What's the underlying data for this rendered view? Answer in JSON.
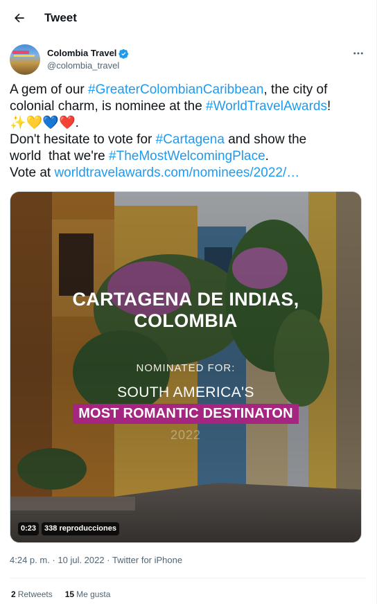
{
  "header": {
    "title": "Tweet"
  },
  "author": {
    "name": "Colombia Travel",
    "handle": "@colombia_travel"
  },
  "tweet": {
    "line1_pre": "A gem of our ",
    "line1_tag": "#GreaterColombianCaribbean",
    "line1_post": ", the city of",
    "line2_pre": "colonial charm, is nominee at the ",
    "line2_tag": "#WorldTravelAwards",
    "line2_post": "!",
    "line3_emoji": "✨💛💙❤️",
    "line3_post": ".",
    "line4_pre": "Don't hesitate to vote for ",
    "line4_tag": "#Cartagena",
    "line4_post": " and show the",
    "line5_pre": "world  that we're ",
    "line5_tag": "#TheMostWelcomingPlace",
    "line5_post": ".",
    "line6_pre": "Vote at ",
    "line6_link": "worldtravelawards.com/nominees/2022/…"
  },
  "media": {
    "city_line1": "CARTAGENA DE INDIAS,",
    "city_line2": "COLOMBIA",
    "nominated": "NOMINATED FOR:",
    "region": "SOUTH AMERICA'S",
    "banner": "MOST ROMANTIC DESTINATON",
    "year": "2022",
    "duration": "0:23",
    "views": "338 reproducciones"
  },
  "meta": {
    "time": "4:24 p. m.",
    "sep1": " · ",
    "date": "10 jul. 2022",
    "sep2": " · ",
    "source": "Twitter for iPhone"
  },
  "stats": {
    "retweets_count": "2",
    "retweets_label": "Retweets",
    "likes_count": "15",
    "likes_label": "Me gusta"
  },
  "colors": {
    "link": "#1d9bf0",
    "banner": "#a52680",
    "verified": "#1d9bf0"
  },
  "icons": [
    "back-arrow-icon",
    "verified-badge-icon",
    "more-options-icon"
  ]
}
